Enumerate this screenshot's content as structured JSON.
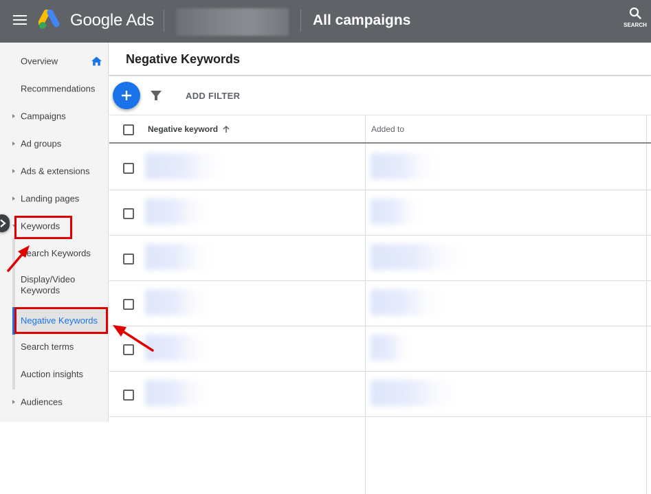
{
  "topbar": {
    "menu_icon": "hamburger-menu-icon",
    "logo_icon": "google-ads-logo-icon",
    "brand": "Google Ads",
    "account_selector": "[redacted account name]",
    "scope_title": "All campaigns",
    "search_label": "SEARCH",
    "search_icon": "search-icon",
    "colors": {
      "bar": "#5f6368",
      "text": "#ffffff"
    }
  },
  "sidebar": {
    "items": [
      {
        "label": "Overview",
        "has_caret": false,
        "icon": "home-icon"
      },
      {
        "label": "Recommendations",
        "has_caret": false
      },
      {
        "label": "Campaigns",
        "has_caret": true
      },
      {
        "label": "Ad groups",
        "has_caret": true
      },
      {
        "label": "Ads & extensions",
        "has_caret": true
      },
      {
        "label": "Landing pages",
        "has_caret": true
      },
      {
        "label": "Keywords",
        "has_caret": true,
        "expanded": true,
        "annotated": true
      },
      {
        "label": "Audiences",
        "has_caret": true
      }
    ],
    "keywords_subitems": [
      {
        "label": "Search Keywords",
        "active": false
      },
      {
        "label": "Display/Video Keywords",
        "active": false
      },
      {
        "label": "Negative Keywords",
        "active": true,
        "annotated": true
      },
      {
        "label": "Search terms",
        "active": false
      },
      {
        "label": "Auction insights",
        "active": false
      }
    ],
    "collapse_icon": "chevron-double-icon",
    "colors": {
      "active_text": "#1a73e8",
      "active_bg": "#e3e3e3",
      "annotation": "#e00000"
    }
  },
  "main": {
    "page_title": "Negative Keywords",
    "toolbar": {
      "add_icon": "plus-icon",
      "filter_icon": "funnel-icon",
      "add_filter_label": "ADD FILTER"
    },
    "table": {
      "columns": [
        {
          "label": "Negative keyword",
          "sort": "ascending",
          "sort_icon": "arrow-up-icon"
        },
        {
          "label": "Added to"
        }
      ],
      "rows": [
        {
          "negative_keyword": "[blurred]",
          "added_to": "[blurred]",
          "checked": false
        },
        {
          "negative_keyword": "[blurred]",
          "added_to": "[blurred]",
          "checked": false
        },
        {
          "negative_keyword": "[blurred]",
          "added_to": "[blurred]",
          "checked": false
        },
        {
          "negative_keyword": "[blurred]",
          "added_to": "[blurred]",
          "checked": false
        },
        {
          "negative_keyword": "[blurred]",
          "added_to": "[blurred]",
          "checked": false
        },
        {
          "negative_keyword": "[blurred]",
          "added_to": "[blurred]",
          "checked": false
        }
      ]
    },
    "colors": {
      "accent": "#1a73e8"
    }
  }
}
